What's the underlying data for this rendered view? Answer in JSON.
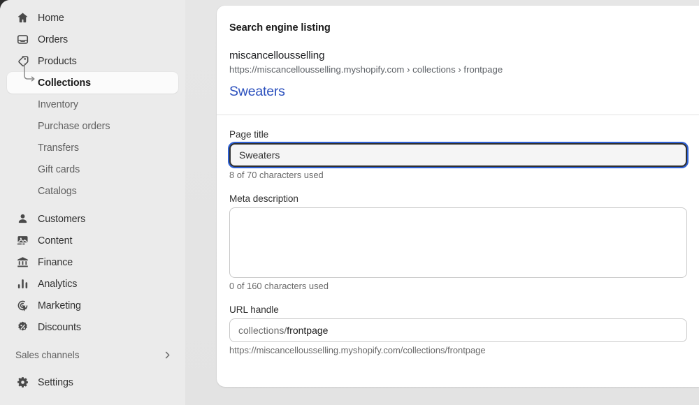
{
  "sidebar": {
    "items": [
      {
        "label": "Home",
        "icon": "home-icon",
        "type": "main",
        "state": "normal"
      },
      {
        "label": "Orders",
        "icon": "orders-icon",
        "type": "main",
        "state": "normal"
      },
      {
        "label": "Products",
        "icon": "tag-icon",
        "type": "main",
        "state": "normal"
      },
      {
        "label": "Collections",
        "icon": "none",
        "type": "sub",
        "state": "active"
      },
      {
        "label": "Inventory",
        "icon": "none",
        "type": "sub",
        "state": "normal"
      },
      {
        "label": "Purchase orders",
        "icon": "none",
        "type": "sub",
        "state": "normal"
      },
      {
        "label": "Transfers",
        "icon": "none",
        "type": "sub",
        "state": "normal"
      },
      {
        "label": "Gift cards",
        "icon": "none",
        "type": "sub",
        "state": "normal"
      },
      {
        "label": "Catalogs",
        "icon": "none",
        "type": "sub",
        "state": "normal"
      },
      {
        "label": "Customers",
        "icon": "person-icon",
        "type": "main",
        "state": "normal"
      },
      {
        "label": "Content",
        "icon": "image-icon",
        "type": "main",
        "state": "normal"
      },
      {
        "label": "Finance",
        "icon": "bank-icon",
        "type": "main",
        "state": "normal"
      },
      {
        "label": "Analytics",
        "icon": "bar-chart-icon",
        "type": "main",
        "state": "normal"
      },
      {
        "label": "Marketing",
        "icon": "target-icon",
        "type": "main",
        "state": "normal"
      },
      {
        "label": "Discounts",
        "icon": "discount-icon",
        "type": "main",
        "state": "normal"
      }
    ],
    "sales_channels": {
      "label": "Sales channels",
      "chevron": "chevron-right-icon"
    },
    "settings": {
      "label": "Settings",
      "icon": "gear-icon"
    }
  },
  "card": {
    "title": "Search engine listing",
    "preview": {
      "site_name": "miscancellousselling",
      "url_crumb": "https://miscancellousselling.myshopify.com › collections › frontpage",
      "link_title": "Sweaters",
      "link_color": "#2a4fbd"
    },
    "page_title": {
      "label": "Page title",
      "value": "Sweaters",
      "placeholder": "",
      "help": "8 of 70 characters used",
      "focused": true
    },
    "meta_description": {
      "label": "Meta description",
      "value": "",
      "placeholder": "",
      "help": "0 of 160 characters used"
    },
    "url_handle": {
      "label": "URL handle",
      "prefix": "collections/",
      "value": "frontpage",
      "help": "https://miscancellousselling.myshopify.com/collections/frontpage"
    }
  }
}
